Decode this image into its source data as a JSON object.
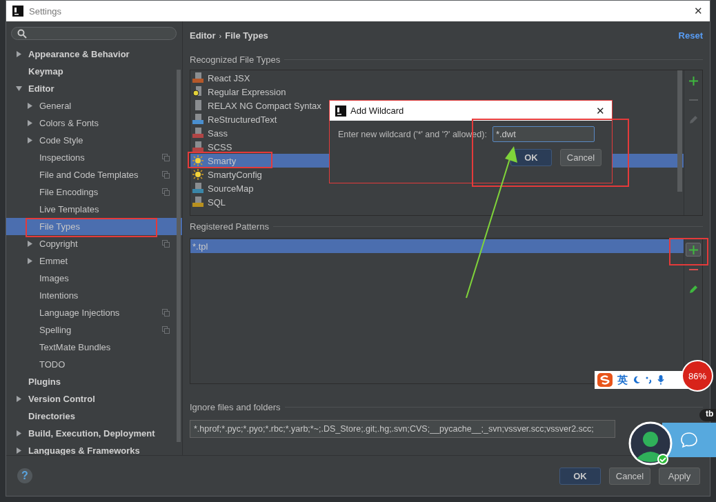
{
  "window": {
    "title": "Settings",
    "close": "✕"
  },
  "sidebar": {
    "items": [
      {
        "label": "Appearance & Behavior",
        "kind": "group",
        "expanded": false,
        "selected": false,
        "per_project": false
      },
      {
        "label": "Keymap",
        "kind": "page",
        "selected": false,
        "per_project": false
      },
      {
        "label": "Editor",
        "kind": "group",
        "expanded": true,
        "selected": false,
        "per_project": false,
        "children": [
          {
            "label": "General",
            "kind": "group",
            "expanded": false,
            "selected": false,
            "per_project": false
          },
          {
            "label": "Colors & Fonts",
            "kind": "group",
            "expanded": false,
            "selected": false,
            "per_project": false
          },
          {
            "label": "Code Style",
            "kind": "group",
            "expanded": false,
            "selected": false,
            "per_project": false
          },
          {
            "label": "Inspections",
            "kind": "page",
            "selected": false,
            "per_project": true
          },
          {
            "label": "File and Code Templates",
            "kind": "page",
            "selected": false,
            "per_project": true
          },
          {
            "label": "File Encodings",
            "kind": "page",
            "selected": false,
            "per_project": true
          },
          {
            "label": "Live Templates",
            "kind": "page",
            "selected": false,
            "per_project": false
          },
          {
            "label": "File Types",
            "kind": "page",
            "selected": true,
            "per_project": false
          },
          {
            "label": "Copyright",
            "kind": "group",
            "expanded": false,
            "selected": false,
            "per_project": true
          },
          {
            "label": "Emmet",
            "kind": "group",
            "expanded": false,
            "selected": false,
            "per_project": false
          },
          {
            "label": "Images",
            "kind": "page",
            "selected": false,
            "per_project": false
          },
          {
            "label": "Intentions",
            "kind": "page",
            "selected": false,
            "per_project": false
          },
          {
            "label": "Language Injections",
            "kind": "page",
            "selected": false,
            "per_project": true
          },
          {
            "label": "Spelling",
            "kind": "page",
            "selected": false,
            "per_project": true
          },
          {
            "label": "TextMate Bundles",
            "kind": "page",
            "selected": false,
            "per_project": false
          },
          {
            "label": "TODO",
            "kind": "page",
            "selected": false,
            "per_project": false
          }
        ]
      },
      {
        "label": "Plugins",
        "kind": "page",
        "selected": false,
        "per_project": false
      },
      {
        "label": "Version Control",
        "kind": "group",
        "expanded": false,
        "selected": false,
        "per_project": false
      },
      {
        "label": "Directories",
        "kind": "page",
        "selected": false,
        "per_project": false
      },
      {
        "label": "Build, Execution, Deployment",
        "kind": "group",
        "expanded": false,
        "selected": false,
        "per_project": false
      },
      {
        "label": "Languages & Frameworks",
        "kind": "group",
        "expanded": false,
        "selected": false,
        "per_project": false
      }
    ]
  },
  "breadcrumb": {
    "items": [
      "Editor",
      "File Types"
    ],
    "separator": "›"
  },
  "reset": "Reset",
  "recognized": {
    "title": "Recognized File Types",
    "items": [
      {
        "label": "React JSX",
        "kind": "jsx",
        "selected": false
      },
      {
        "label": "Regular Expression",
        "kind": "regex",
        "selected": false
      },
      {
        "label": "RELAX NG Compact Syntax",
        "kind": "text",
        "selected": false
      },
      {
        "label": "ReStructuredText",
        "kind": "rst",
        "selected": false
      },
      {
        "label": "Sass",
        "kind": "sass",
        "selected": false
      },
      {
        "label": "SCSS",
        "kind": "sass",
        "selected": false
      },
      {
        "label": "Smarty",
        "kind": "smarty",
        "selected": true
      },
      {
        "label": "SmartyConfig",
        "kind": "smarty",
        "selected": false
      },
      {
        "label": "SourceMap",
        "kind": "json",
        "selected": false
      },
      {
        "label": "SQL",
        "kind": "sql",
        "selected": false
      }
    ],
    "tools": [
      {
        "kind": "add",
        "disabled": false
      },
      {
        "kind": "remove",
        "disabled": true
      },
      {
        "kind": "edit",
        "disabled": true
      }
    ]
  },
  "patterns": {
    "title": "Registered Patterns",
    "items": [
      {
        "label": "*.tpl",
        "selected": true
      }
    ],
    "tools": [
      {
        "kind": "add",
        "disabled": false
      },
      {
        "kind": "remove",
        "disabled": false
      },
      {
        "kind": "edit",
        "disabled": false
      }
    ]
  },
  "ignore": {
    "title": "Ignore files and folders",
    "value": "*.hprof;*.pyc;*.pyo;*.rbc;*.yarb;*~;.DS_Store;.git;.hg;.svn;CVS;__pycache__;_svn;vssver.scc;vssver2.scc;"
  },
  "help": "?",
  "buttons": [
    {
      "label": "OK",
      "kind": "primary"
    },
    {
      "label": "Cancel",
      "kind": "normal"
    },
    {
      "label": "Apply",
      "kind": "normal"
    }
  ],
  "dialog": {
    "title": "Add Wildcard",
    "close": "✕",
    "prompt": "Enter new wildcard ('*' and '?' allowed):",
    "value": "*.dwt",
    "buttons": [
      {
        "label": "OK",
        "kind": "primary"
      },
      {
        "label": "Cancel",
        "kind": "normal"
      }
    ]
  },
  "ime_toolbar": {
    "label": "英"
  },
  "memory_badge": {
    "text": "86%"
  },
  "side_tag": "tb"
}
